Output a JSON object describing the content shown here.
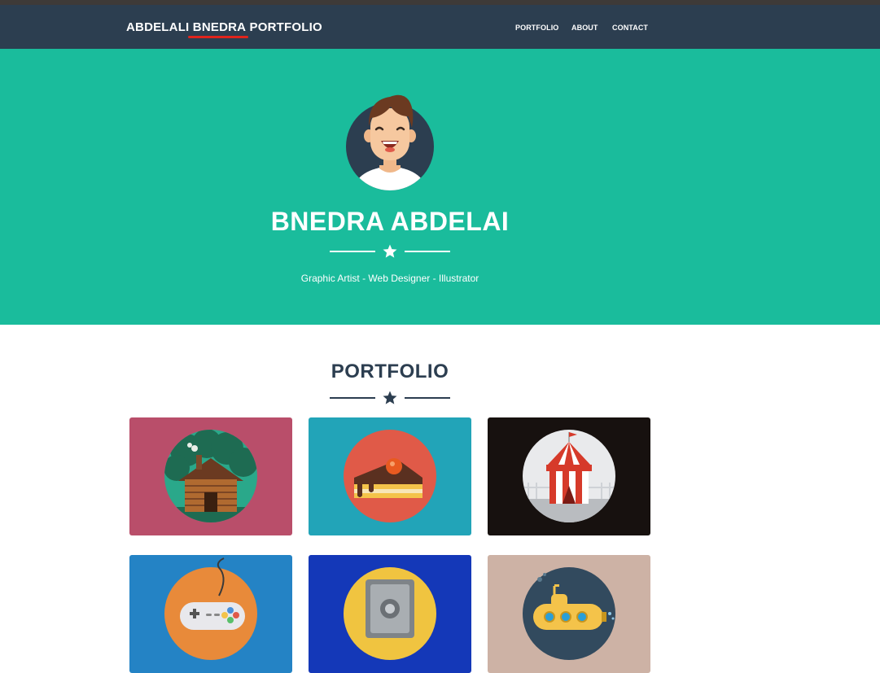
{
  "navbar": {
    "brand_pre": "ABDELALI ",
    "brand_mid": "BNEDRA",
    "brand_post": " PORTFOLIO",
    "links": [
      "PORTFOLIO",
      "ABOUT",
      "CONTACT"
    ]
  },
  "hero": {
    "name": "BNEDRA ABDELAI",
    "tagline": "Graphic Artist - Web Designer - Illustrator"
  },
  "portfolio": {
    "title": "PORTFOLIO",
    "items": [
      {
        "subject": "cabin",
        "bg": "#b94e6a"
      },
      {
        "subject": "cake",
        "bg": "#22a4b8"
      },
      {
        "subject": "circus",
        "bg": "#17110f"
      },
      {
        "subject": "game-controller",
        "bg": "#2483c5"
      },
      {
        "subject": "safe",
        "bg": "#1438b8"
      },
      {
        "subject": "submarine",
        "bg": "#cdb2a5"
      }
    ]
  },
  "colors": {
    "navbar": "#2c3e50",
    "accent": "#1abc9c",
    "underline": "#e0241c"
  }
}
